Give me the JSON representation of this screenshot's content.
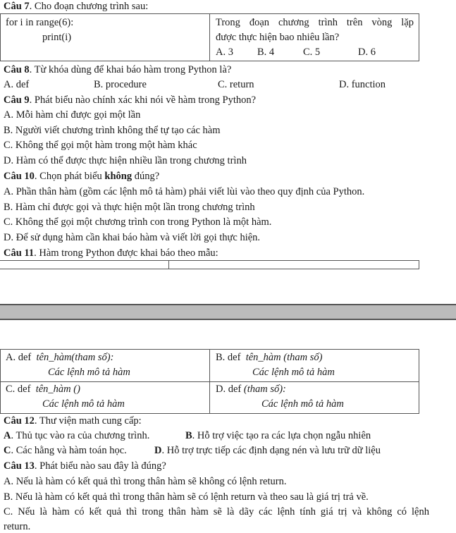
{
  "q7": {
    "number": "Câu 7",
    "prompt": ". Cho đoạn chương trình sau:",
    "code_line1": "for  i  in range(6):",
    "code_line2": "print(i)",
    "question_line1": "Trong  đoạn  chương  trình  trên  vòng  lặp",
    "question_line2": "được thực hiện bao nhiêu lần?",
    "options": [
      "A. 3",
      "B. 4",
      "C. 5",
      "D. 6"
    ]
  },
  "q8": {
    "number": "Câu 8",
    "prompt": ". Từ khóa dùng để khai báo hàm trong Python là?",
    "options": [
      "A. def",
      "B. procedure",
      "C. return",
      "D. function"
    ]
  },
  "q9": {
    "number": "Câu 9",
    "prompt": ". Phát biểu nào chính xác khi nói về hàm trong Python?",
    "options": [
      "A. Mỗi hàm chỉ được gọi một lần",
      "B. Người viết chương trình không thể tự tạo các hàm",
      "C. Không thể gọi một hàm trong một hàm khác",
      "D. Hàm có thể được thực hiện nhiều lần trong chương trình"
    ]
  },
  "q10": {
    "number": "Câu 10",
    "prompt_before": ". Chọn phát biểu ",
    "prompt_bold": "không",
    "prompt_after": " đúng?",
    "options": [
      "A. Phần thân hàm (gồm các lệnh mô tả hàm) phải viết lùi vào theo quy định của Python.",
      "B. Hàm chỉ được gọi và thực hiện một lần trong chương trình",
      "C. Không thể gọi một chương trình con trong Python là một hàm.",
      "D. Để sử dụng hàm cần khai báo hàm và viết lời gọi thực hiện."
    ]
  },
  "q11": {
    "number": "Câu 11",
    "prompt": ". Hàm trong Python được khai báo theo mẫu:",
    "options": [
      {
        "label": "A. def",
        "head": "tên_hàm(tham số):",
        "body": "Các lệnh mô tả hàm"
      },
      {
        "label": "B. def",
        "head": "tên_hàm (tham số)",
        "body": "Các lệnh mô tả hàm"
      },
      {
        "label": "C. def",
        "head": "tên_hàm ()",
        "body": "Các lệnh mô tả hàm"
      },
      {
        "label": "D. def",
        "head": "(tham số):",
        "body": "Các lệnh mô tả hàm"
      }
    ]
  },
  "q12": {
    "number": "Câu 12",
    "prompt": ". Thư viện math cung cấp:",
    "options": [
      {
        "letter": "A",
        "text": ". Thủ tục vào ra của chương trình."
      },
      {
        "letter": "B",
        "text": ". Hỗ trợ việc tạo ra các lựa chọn ngẫu nhiên"
      },
      {
        "letter": "C",
        "text": ". Các hằng và hàm toán học."
      },
      {
        "letter": "D",
        "text": ". Hỗ trợ trực tiếp các định dạng nén và lưu trữ dữ liệu"
      }
    ]
  },
  "q13": {
    "number": "Câu 13",
    "prompt": ". Phát biểu nào sau đây là đúng?",
    "options": [
      "A. Nếu là hàm có kết quả thì trong thân hàm sẽ không có lệnh return.",
      "B. Nếu là hàm có kết quả thì trong thân hàm sẽ có lệnh return và theo sau là giá trị trả về.",
      "C. Nếu là hàm có kết quả thì trong thân hàm sẽ là dãy các lệnh tính giá trị và không có lệnh",
      "return."
    ]
  }
}
